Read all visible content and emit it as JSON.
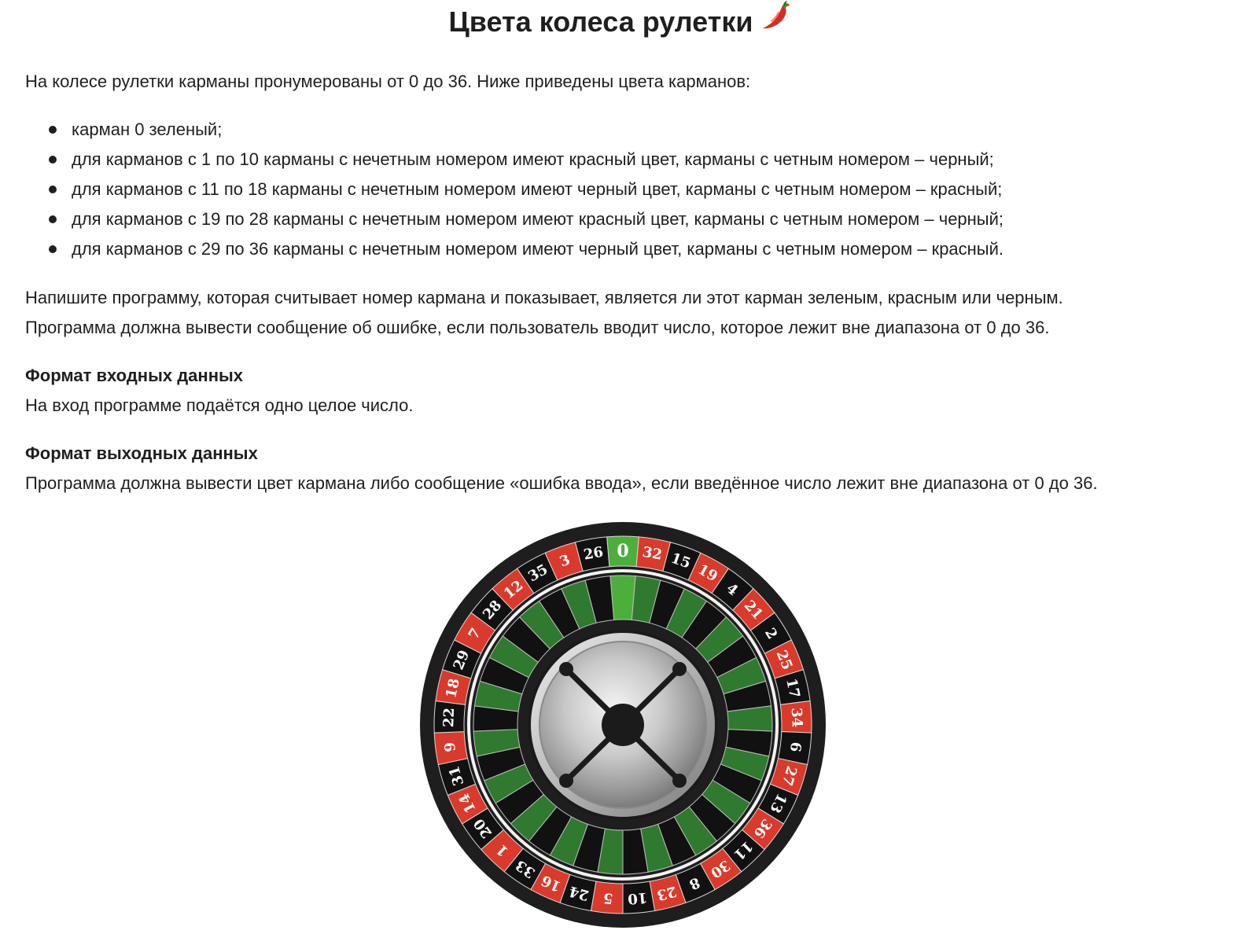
{
  "title": "Цвета колеса рулетки",
  "title_icon": "chili-pepper-icon",
  "intro": "На колесе рулетки карманы пронумерованы от 0 до 36. Ниже приведены цвета карманов:",
  "rules": [
    "карман 0 зеленый;",
    "для карманов с 1 по 10 карманы с нечетным номером имеют красный цвет, карманы с четным номером – черный;",
    "для карманов с 11 по 18 карманы с нечетным номером имеют черный цвет, карманы с четным номером – красный;",
    "для карманов с 19 по 28 карманы с нечетным номером имеют красный цвет, карманы с четным номером – черный;",
    "для карманов с 29 по 36 карманы с нечетным номером имеют черный цвет, карманы с четным номером – красный."
  ],
  "task": {
    "line1": "Напишите программу, которая считывает номер кармана и показывает, является ли этот карман зеленым, красным или черным.",
    "line2": "Программа должна вывести сообщение об ошибке, если пользователь вводит число, которое лежит вне диапазона от 0 до 36."
  },
  "input_format": {
    "heading": "Формат входных данных",
    "text": "На вход программе подаётся одно целое число."
  },
  "output_format": {
    "heading": "Формат выходных данных",
    "text": "Программа должна вывести цвет кармана либо сообщение «ошибка ввода», если введённое число лежит вне диапазона от 0 до 36."
  },
  "wheel": {
    "numbers": [
      "0",
      "32",
      "15",
      "19",
      "4",
      "21",
      "2",
      "25",
      "17",
      "34",
      "6",
      "27",
      "13",
      "36",
      "11",
      "30",
      "8",
      "23",
      "10",
      "5",
      "24",
      "16",
      "33",
      "1",
      "20",
      "14",
      "31",
      "9",
      "22",
      "18",
      "29",
      "7",
      "28",
      "12",
      "35",
      "3",
      "26"
    ],
    "colors": {
      "green": "#4caf3c",
      "red": "#d93a2b",
      "black": "#111111",
      "rim": "#1e1e1e",
      "inner_green": "#2f7a2f"
    }
  }
}
